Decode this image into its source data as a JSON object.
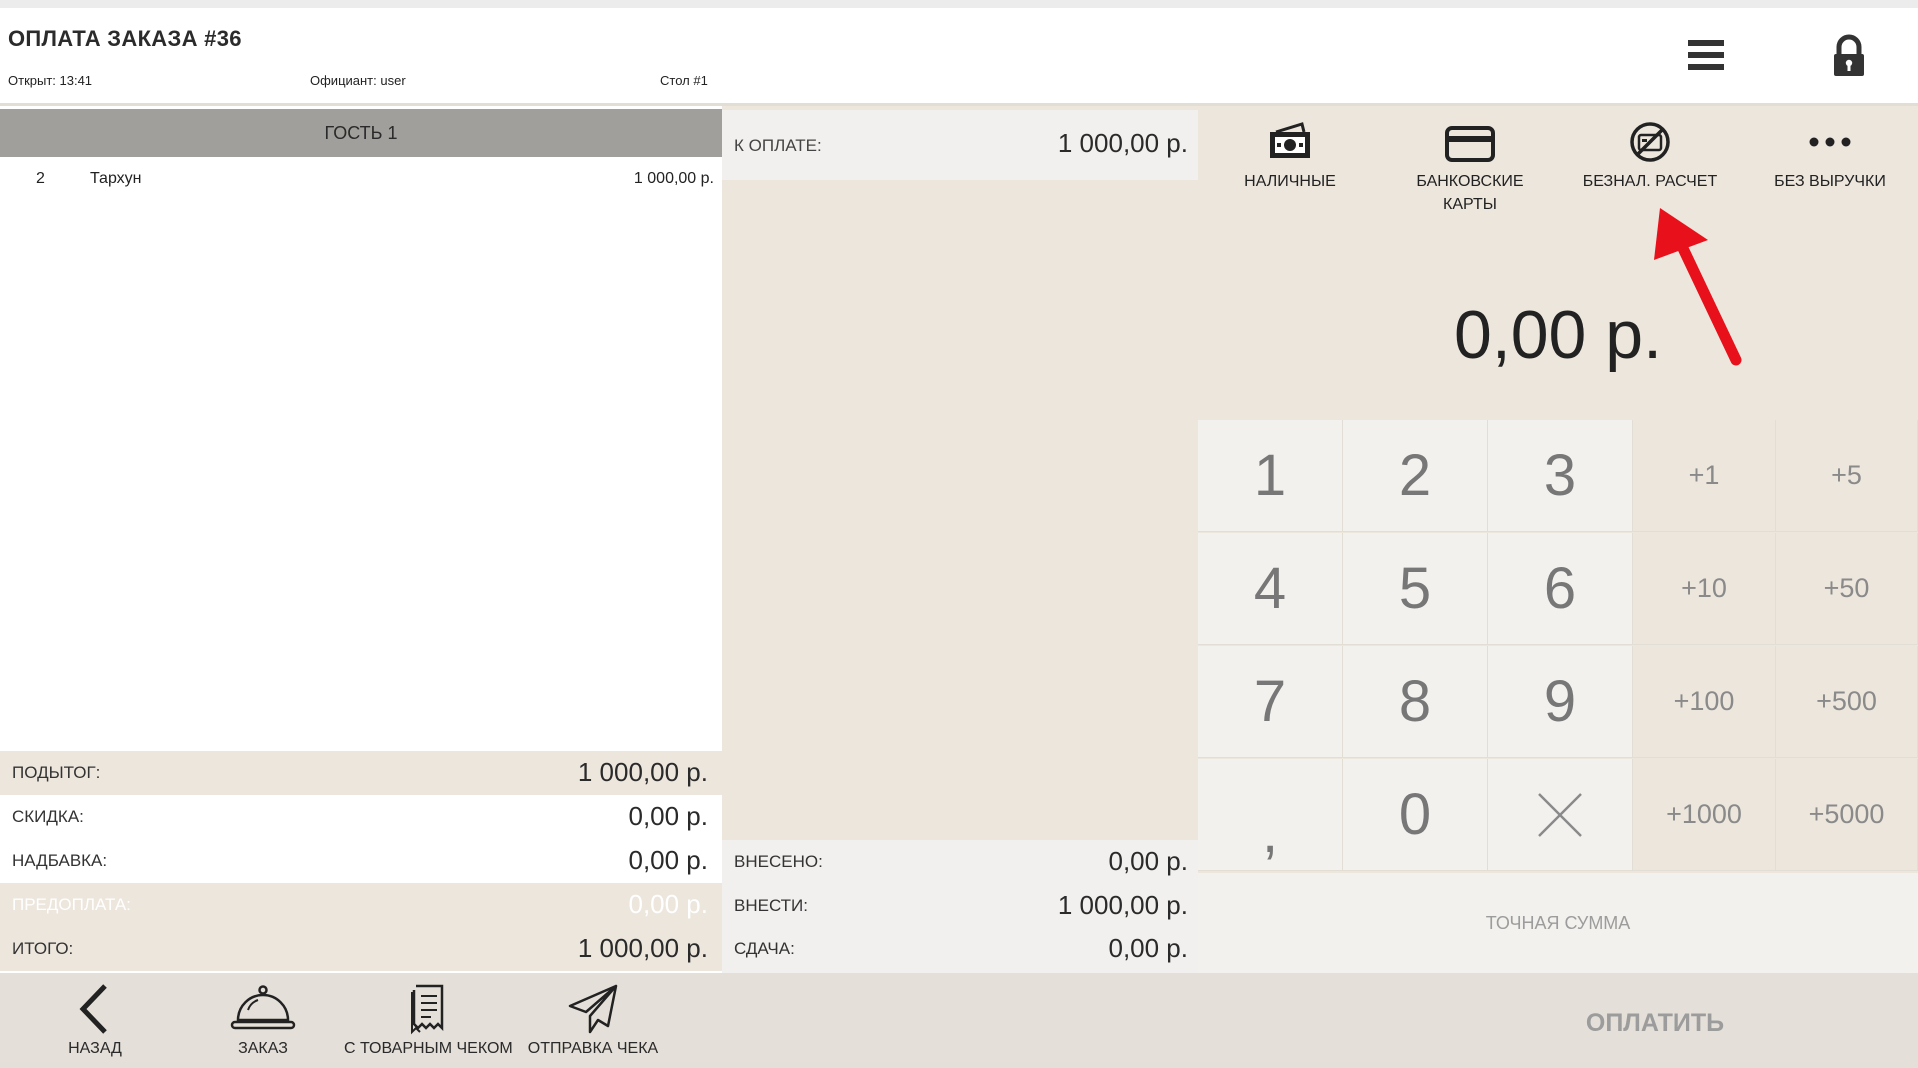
{
  "header": {
    "title": "ОПЛАТА ЗАКАЗА #36",
    "opened": "Открыт: 13:41",
    "waiter": "Официант: user",
    "table": "Стол #1"
  },
  "order": {
    "guest_label": "ГОСТЬ 1",
    "items": [
      {
        "qty": "2",
        "name": "Тархун",
        "price": "1 000,00 р."
      }
    ]
  },
  "summary": {
    "subtotal_label": "ПОДЫТОГ:",
    "subtotal_value": "1 000,00 р.",
    "discount_label": "СКИДКА:",
    "discount_value": "0,00 р.",
    "surcharge_label": "НАДБАВКА:",
    "surcharge_value": "0,00 р.",
    "prepayment_label": "ПРЕДОПЛАТА:",
    "prepayment_value": "0,00 р.",
    "total_label": "ИТОГО:",
    "total_value": "1 000,00 р."
  },
  "payment": {
    "due_label": "К ОПЛАТЕ:",
    "due_value": "1 000,00 р.",
    "paid_label": "ВНЕСЕНО:",
    "paid_value": "0,00 р.",
    "to_pay_label": "ВНЕСТИ:",
    "to_pay_value": "1 000,00 р.",
    "change_label": "СДАЧА:",
    "change_value": "0,00 р."
  },
  "methods": {
    "cash": "НАЛИЧНЫЕ",
    "cards_line1": "БАНКОВСКИЕ",
    "cards_line2": "КАРТЫ",
    "noncash": "БЕЗНАЛ. РАСЧЕТ",
    "no_revenue": "БЕЗ ВЫРУЧКИ"
  },
  "amount_display": "0,00 р.",
  "keypad": {
    "digits": [
      "1",
      "2",
      "3",
      "4",
      "5",
      "6",
      "7",
      "8",
      "9",
      ",",
      "0"
    ],
    "adds": [
      "+1",
      "+5",
      "+10",
      "+50",
      "+100",
      "+500",
      "+1000",
      "+5000"
    ]
  },
  "exact_sum": "ТОЧНАЯ СУММА",
  "bottom": {
    "back": "НАЗАД",
    "order": "ЗАКАЗ",
    "with_receipt": "С ТОВАРНЫМ ЧЕКОМ",
    "send_receipt": "ОТПРАВКА ЧЕКА",
    "pay": "ОПЛАТИТЬ"
  },
  "colors": {
    "beige": "#ece6dd",
    "guest_header": "#a09f9c",
    "keypad": "#f3f1ee",
    "annotation_arrow": "#e8101a"
  }
}
